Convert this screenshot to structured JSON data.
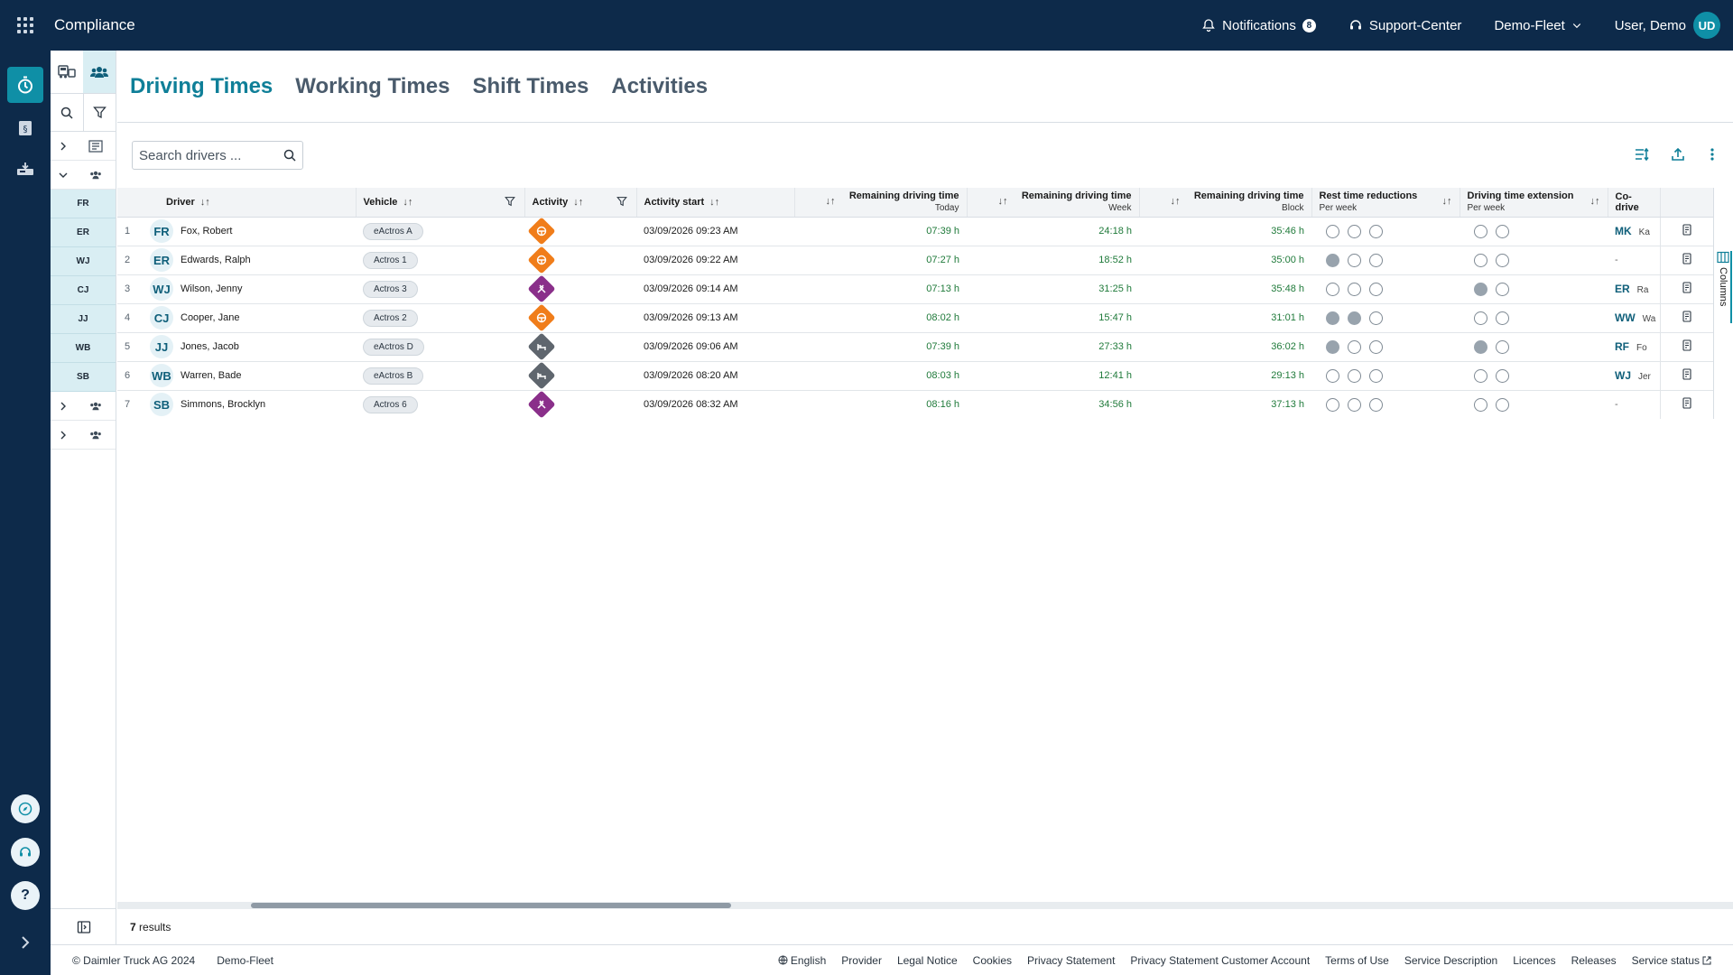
{
  "app": {
    "title": "Compliance"
  },
  "header": {
    "notifications_label": "Notifications",
    "notifications_count": "8",
    "support_label": "Support-Center",
    "fleet_label": "Demo-Fleet",
    "user_label": "User, Demo",
    "user_initials": "UD"
  },
  "sidebar": {
    "drivers": [
      "FR",
      "ER",
      "WJ",
      "CJ",
      "JJ",
      "WB",
      "SB"
    ]
  },
  "tabs": [
    "Driving Times",
    "Working Times",
    "Shift Times",
    "Activities"
  ],
  "search": {
    "placeholder": "Search drivers ..."
  },
  "table": {
    "headers": {
      "driver": "Driver",
      "vehicle": "Vehicle",
      "activity": "Activity",
      "activity_start": "Activity start",
      "rdt_today": "Remaining driving time",
      "rdt_today_sub": "Today",
      "rdt_week": "Remaining driving time",
      "rdt_week_sub": "Week",
      "rdt_block": "Remaining driving time",
      "rdt_block_sub": "Block",
      "rest_red": "Rest time reductions",
      "rest_red_sub": "Per week",
      "dte": "Driving time extension",
      "dte_sub": "Per week",
      "codriver": "Co-drive"
    },
    "rows": [
      {
        "n": "1",
        "initials": "FR",
        "name": "Fox, Robert",
        "vehicle": "eActros A",
        "activity": "driving",
        "start": "03/09/2026 09:23 AM",
        "today": "07:39 h",
        "week": "24:18 h",
        "block": "35:46 h",
        "rest": [
          0,
          0,
          0
        ],
        "ext": [
          0,
          0
        ],
        "co_initials": "MK",
        "co_name": "Ka"
      },
      {
        "n": "2",
        "initials": "ER",
        "name": "Edwards, Ralph",
        "vehicle": "Actros 1",
        "activity": "driving",
        "start": "03/09/2026 09:22 AM",
        "today": "07:27 h",
        "week": "18:52 h",
        "block": "35:00 h",
        "rest": [
          1,
          0,
          0
        ],
        "ext": [
          0,
          0
        ],
        "co_initials": "",
        "co_name": "-"
      },
      {
        "n": "3",
        "initials": "WJ",
        "name": "Wilson, Jenny",
        "vehicle": "Actros 3",
        "activity": "work",
        "start": "03/09/2026 09:14 AM",
        "today": "07:13 h",
        "week": "31:25 h",
        "block": "35:48 h",
        "rest": [
          0,
          0,
          0
        ],
        "ext": [
          1,
          0
        ],
        "co_initials": "ER",
        "co_name": "Ra"
      },
      {
        "n": "4",
        "initials": "CJ",
        "name": "Cooper, Jane",
        "vehicle": "Actros 2",
        "activity": "driving",
        "start": "03/09/2026 09:13 AM",
        "today": "08:02 h",
        "week": "15:47 h",
        "block": "31:01 h",
        "rest": [
          1,
          1,
          0
        ],
        "ext": [
          0,
          0
        ],
        "co_initials": "WW",
        "co_name": "Wa"
      },
      {
        "n": "5",
        "initials": "JJ",
        "name": "Jones, Jacob",
        "vehicle": "eActros D",
        "activity": "rest",
        "start": "03/09/2026 09:06 AM",
        "today": "07:39 h",
        "week": "27:33 h",
        "block": "36:02 h",
        "rest": [
          1,
          0,
          0
        ],
        "ext": [
          1,
          0
        ],
        "co_initials": "RF",
        "co_name": "Fo"
      },
      {
        "n": "6",
        "initials": "WB",
        "name": "Warren, Bade",
        "vehicle": "eActros B",
        "activity": "rest",
        "start": "03/09/2026 08:20 AM",
        "today": "08:03 h",
        "week": "12:41 h",
        "block": "29:13 h",
        "rest": [
          0,
          0,
          0
        ],
        "ext": [
          0,
          0
        ],
        "co_initials": "WJ",
        "co_name": "Jer"
      },
      {
        "n": "7",
        "initials": "SB",
        "name": "Simmons, Brocklyn",
        "vehicle": "Actros 6",
        "activity": "work",
        "start": "03/09/2026 08:32 AM",
        "today": "08:16 h",
        "week": "34:56 h",
        "block": "37:13 h",
        "rest": [
          0,
          0,
          0
        ],
        "ext": [
          0,
          0
        ],
        "co_initials": "",
        "co_name": "-"
      }
    ]
  },
  "columns_label": "Columns",
  "results": {
    "count": "7",
    "label": "results"
  },
  "footer": {
    "copyright": "© Daimler Truck AG 2024",
    "fleet": "Demo-Fleet",
    "language": "English",
    "links": [
      "Provider",
      "Legal Notice",
      "Cookies",
      "Privacy Statement",
      "Privacy Statement Customer Account",
      "Terms of Use",
      "Service Description",
      "Licences",
      "Releases",
      "Service status"
    ]
  },
  "colors": {
    "navy": "#0d2a4a",
    "accent": "#0f8fa6",
    "driving": "#f07d1a",
    "work": "#8a2f8a",
    "rest": "#5f666e",
    "remaining": "#1f7a3a"
  }
}
